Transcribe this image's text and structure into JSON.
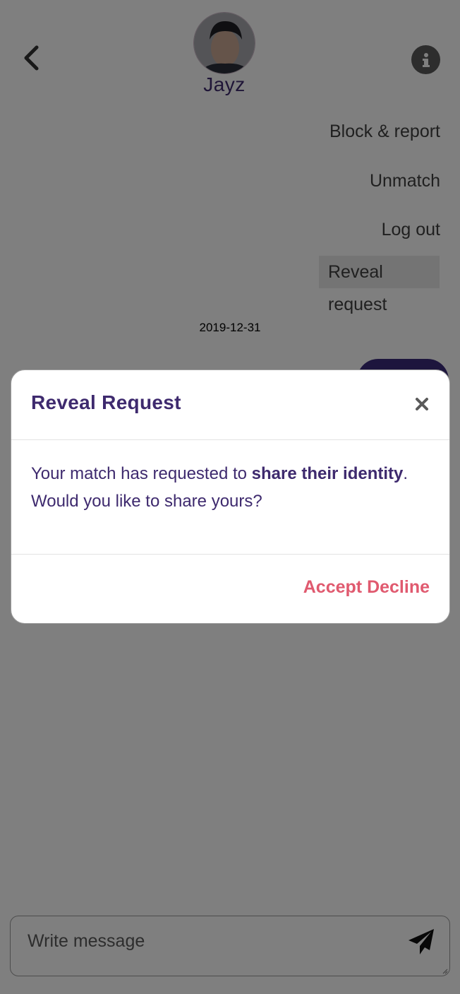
{
  "header": {
    "back_icon": "chevron-left-icon",
    "username": "Jayz",
    "info_icon": "info-icon"
  },
  "menu": {
    "block_report": "Block & report",
    "unmatch": "Unmatch",
    "log_out": "Log out",
    "reveal_request": "Reveal request"
  },
  "chat": {
    "date": "2019-12-31"
  },
  "composer": {
    "placeholder": "Write message",
    "send_icon": "paper-plane-icon"
  },
  "modal": {
    "title": "Reveal Request",
    "close_icon": "close-icon",
    "body_prefix": "Your match has requested to ",
    "body_bold": "share their identity",
    "body_suffix": ". Would you like to share yours?",
    "accept_label": "Accept",
    "decline_label": "Decline"
  },
  "colors": {
    "brand_purple": "#3e2a6e",
    "accent_red": "#e05a6f",
    "overlay": "rgba(0,0,0,0.5)"
  }
}
